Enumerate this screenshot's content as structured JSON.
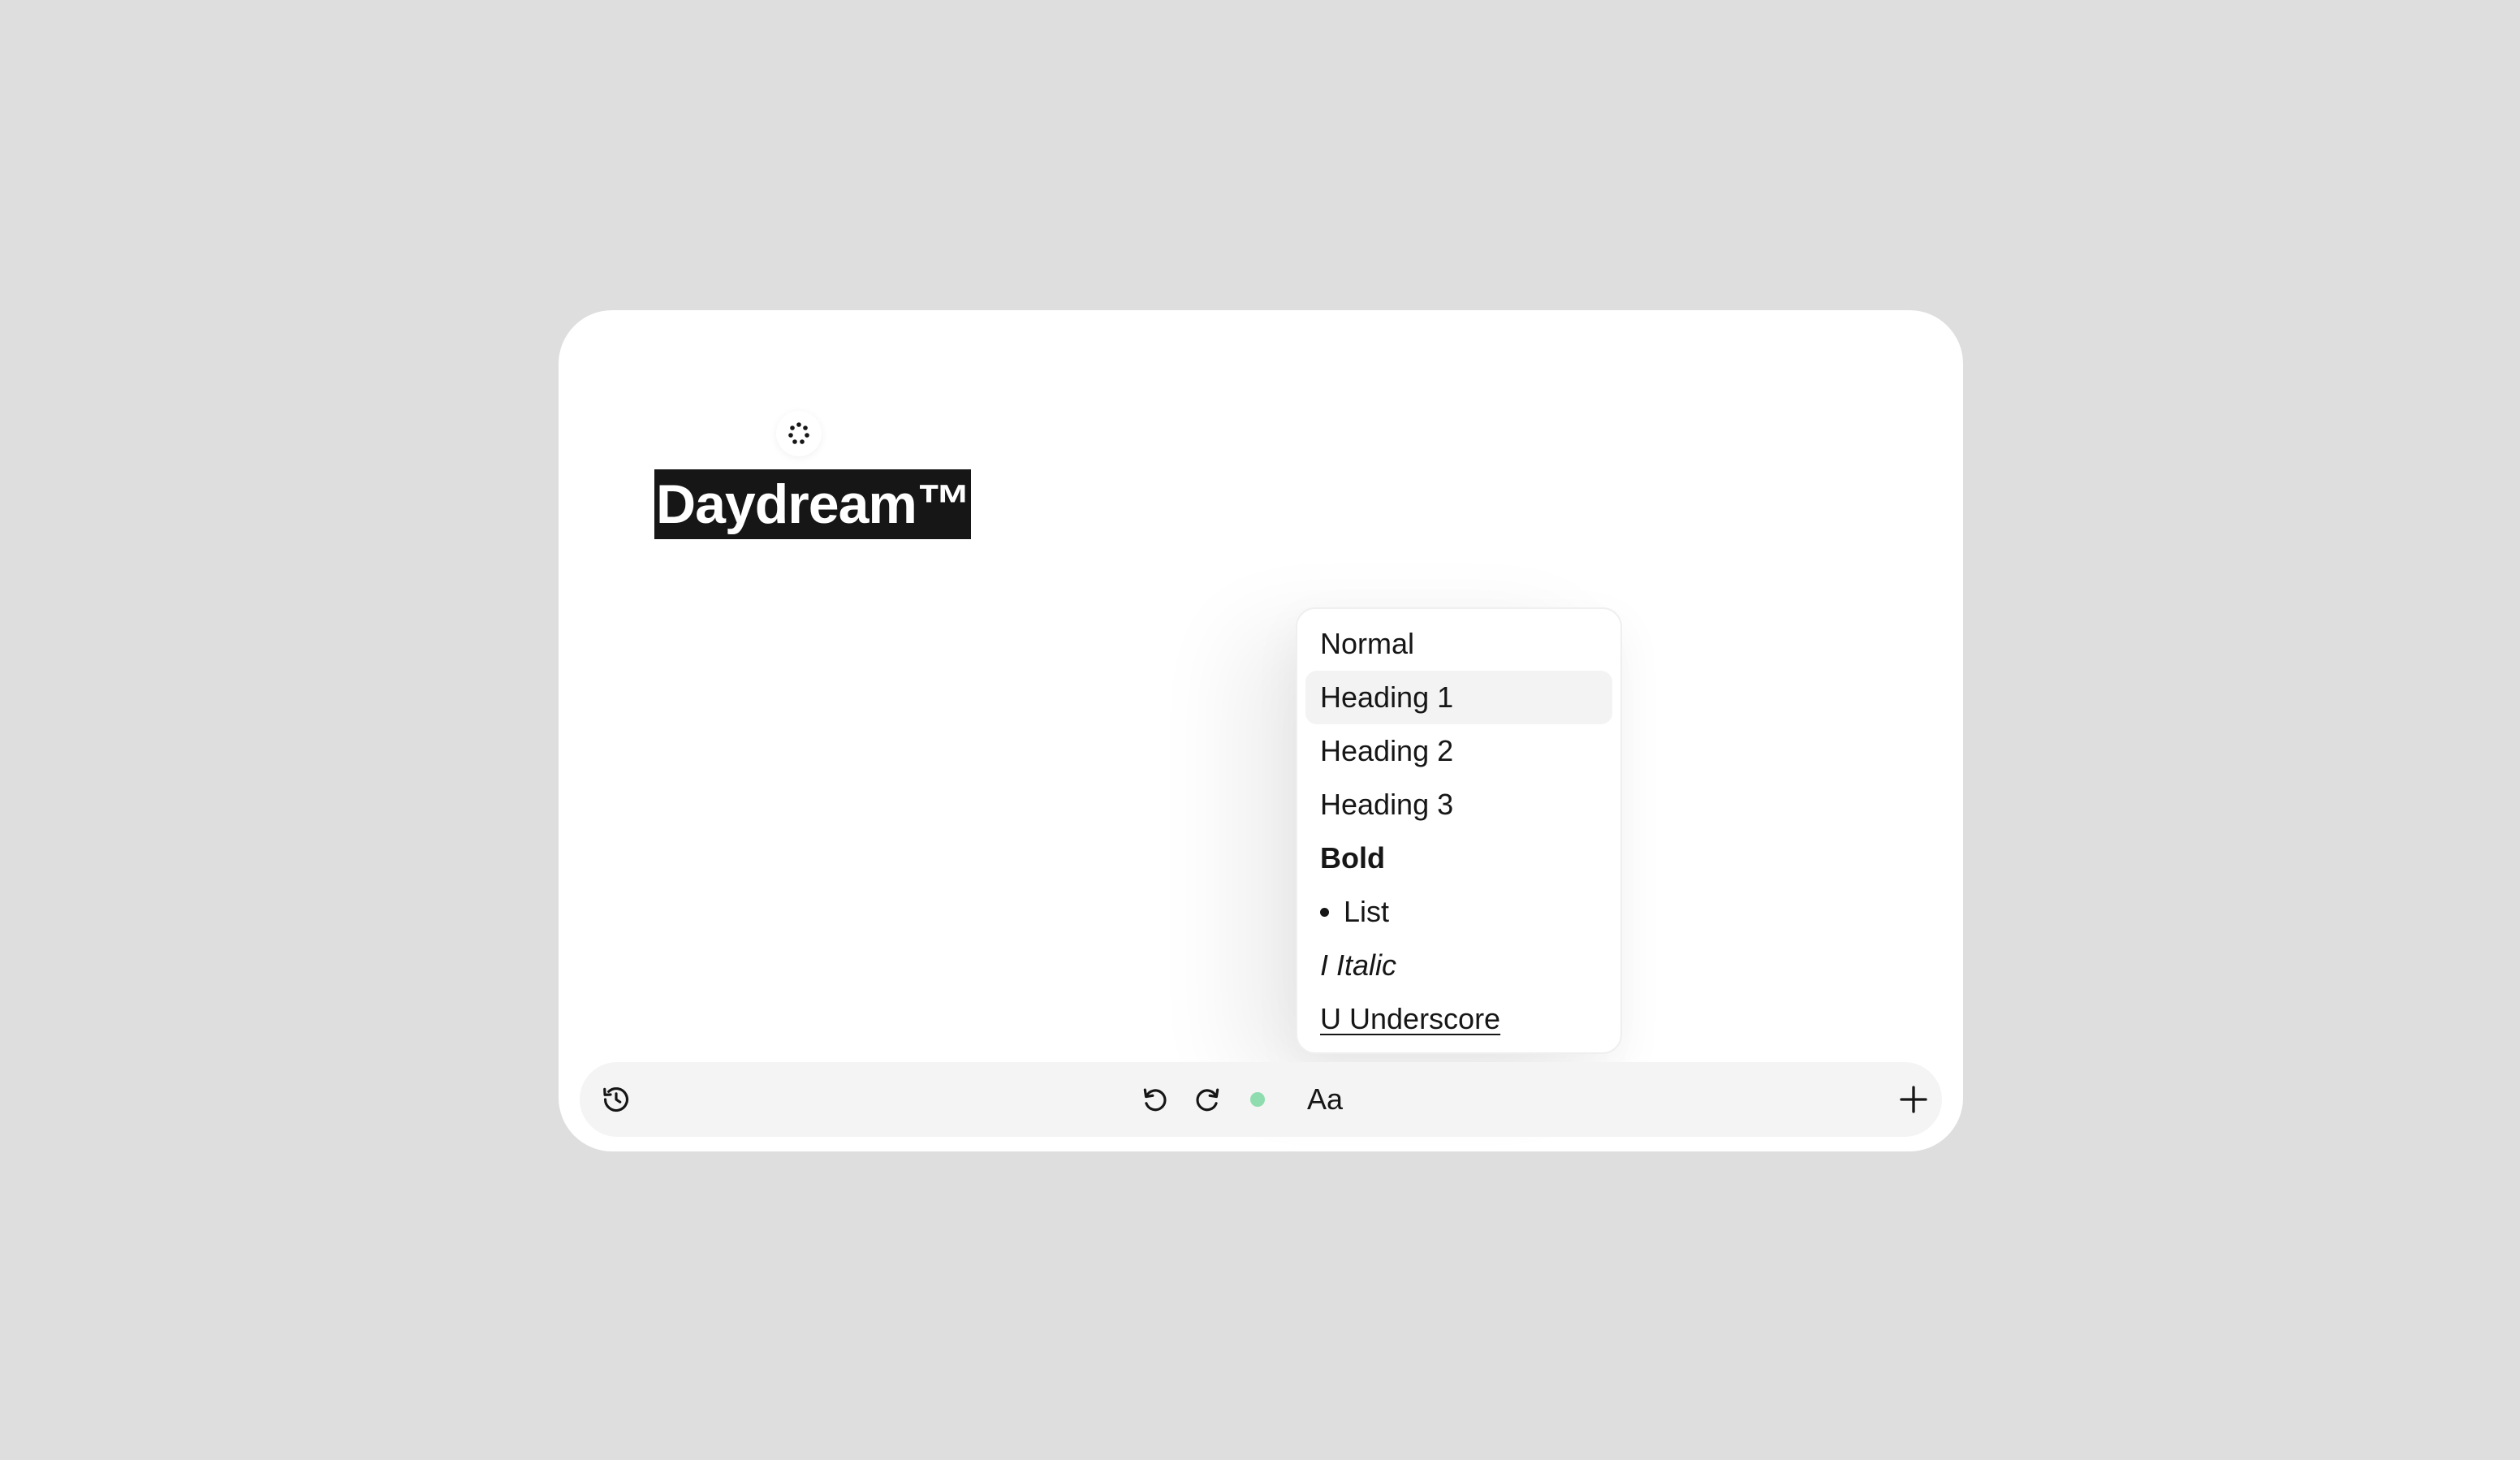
{
  "document": {
    "title": "Daydream™"
  },
  "format_menu": {
    "items": [
      {
        "label": "Normal"
      },
      {
        "label": "Heading 1"
      },
      {
        "label": "Heading 2"
      },
      {
        "label": "Heading 3"
      },
      {
        "label": "Bold"
      },
      {
        "label": "List"
      },
      {
        "label": "I Italic"
      },
      {
        "label": "U Underscore"
      }
    ],
    "highlighted": "Heading 1"
  },
  "toolbar": {
    "font_label": "Aa",
    "status_color": "#8fdcae",
    "icons": {
      "history": "history-icon",
      "undo": "undo-icon",
      "redo": "redo-icon",
      "add": "plus-icon",
      "loading": "spinner-icon"
    }
  },
  "colors": {
    "background": "#dedede",
    "card": "#ffffff",
    "toolbar": "#f4f4f4",
    "title_highlight": "#161616",
    "text": "#161616"
  }
}
